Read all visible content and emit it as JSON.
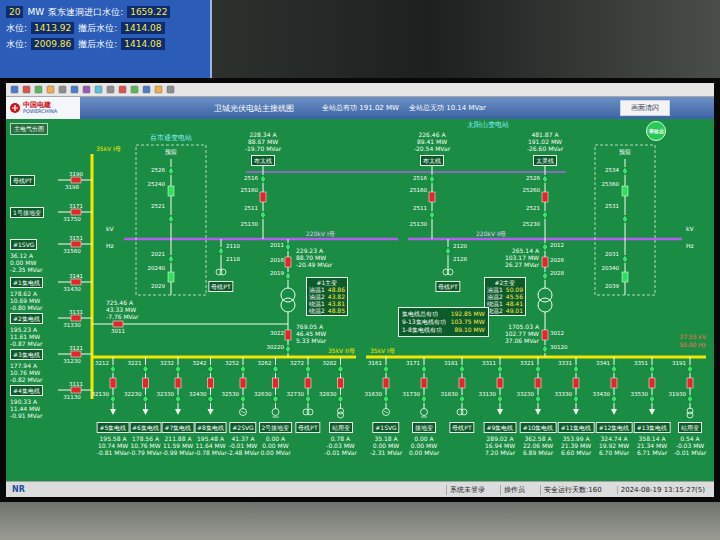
{
  "background_window": {
    "rows": [
      {
        "cells": [
          {
            "text": "20",
            "kind": "value"
          },
          {
            "text": "MW",
            "kind": "label"
          },
          {
            "text": "泵东速洞进口水位:",
            "kind": "label"
          },
          {
            "text": "1659.22",
            "kind": "value"
          }
        ]
      },
      {
        "cells": [
          {
            "text": "水位:",
            "kind": "label"
          },
          {
            "text": "1413.92",
            "kind": "value"
          },
          {
            "text": "撤后水位:",
            "kind": "label"
          },
          {
            "text": "1414.08",
            "kind": "value"
          }
        ]
      },
      {
        "cells": [
          {
            "text": "水位:",
            "kind": "label"
          },
          {
            "text": "2009.86",
            "kind": "value"
          },
          {
            "text": "撤后水位:",
            "kind": "label"
          },
          {
            "text": "1414.08",
            "kind": "value"
          }
        ]
      }
    ]
  },
  "header": {
    "logo": {
      "name": "中国电建",
      "sub": "POWERCHINA"
    },
    "title": "卫城光伏电站主接线图",
    "totals": [
      {
        "label": "全站总有功",
        "value": "191.02 MW"
      },
      {
        "label": "全站总无功",
        "value": "10.14 MVar"
      }
    ],
    "button": "画面清闪"
  },
  "diagram": {
    "nav_button": "主电气分图",
    "accident_lamp": {
      "label": "事故总",
      "active": false
    },
    "stations": [
      "百市通变电站",
      "太阳山变电站"
    ],
    "bus_labels": [
      "35kV I母",
      "35kV II母",
      "35kV I母",
      "220kV I母",
      "220kV II母"
    ],
    "bus220_units": [
      {
        "kv": "kV",
        "hz": "Hz"
      },
      {
        "kv": "kV",
        "hz": "Hz"
      }
    ],
    "bus35_reading": {
      "kv": "37.55 kV",
      "hz": "50.00 Hz"
    },
    "lines": [
      {
        "label": "布太线",
        "readings": [
          "228.34 A",
          "88.67 MW",
          "-19.70 MVar"
        ],
        "switches": [
          "2516",
          "25160",
          "2511",
          "25130"
        ],
        "breaker_closed": true
      },
      {
        "label": "布太线",
        "readings": [
          "226.46 A",
          "89.41 MW",
          "-20.54 MVar"
        ],
        "switches": [
          "2516",
          "25160",
          "2511",
          "25130"
        ],
        "breaker_closed": true
      },
      {
        "label": "太灵线",
        "readings": [
          "481.87 A",
          "191.02 MW",
          "-26.60 MVar"
        ],
        "switches": [
          "2526",
          "25260",
          "2521",
          "25230"
        ],
        "breaker_closed": true
      }
    ],
    "reserves": [
      {
        "label": "预留",
        "switches": [
          "2526",
          "25240",
          "2521",
          "2021",
          "20240",
          "2029"
        ],
        "breaker_closed": false
      },
      {
        "label": "预留",
        "switches": [
          "2534",
          "25360",
          "2531",
          "2031",
          "20340",
          "2039"
        ],
        "breaker_closed": false
      }
    ],
    "pts": [
      {
        "label": "母线PT",
        "switches": [
          "2110",
          "2118"
        ]
      },
      {
        "label": "母线PT",
        "switches": [
          "2120",
          "2128"
        ]
      }
    ],
    "transformers": [
      {
        "name": "#1主变",
        "breaker_closed": true,
        "temps": [
          {
            "label": "油温1",
            "value": "48.86"
          },
          {
            "label": "油温2",
            "value": "43.82"
          },
          {
            "label": "绕温1",
            "value": "43.81"
          },
          {
            "label": "绕温2",
            "value": "48.85"
          }
        ],
        "hv": {
          "switches": [
            "2011",
            "2016",
            "2019"
          ],
          "readings": [
            "229.23 A",
            "88.70 MW",
            "-20.49 MVar"
          ]
        },
        "lv": {
          "switches": [
            "3022",
            "30220"
          ],
          "readings": [
            "769.05 A",
            "46.45 MW",
            "5.33 MVar"
          ]
        },
        "link": {
          "switch": "3011",
          "readings": [
            "725.46 A",
            "43.33 MW",
            "-7.76 MVar"
          ],
          "breaker_closed": true
        }
      },
      {
        "name": "#2主变",
        "breaker_closed": true,
        "temps": [
          {
            "label": "油温1",
            "value": "50.09"
          },
          {
            "label": "油温2",
            "value": "45.56"
          },
          {
            "label": "绕温1",
            "value": "48.41"
          },
          {
            "label": "绕温2",
            "value": "49.01"
          }
        ],
        "hv": {
          "switches": [
            "2012",
            "2026",
            "2028"
          ],
          "readings": [
            "265.14 A",
            "103.17 MW",
            "26.27 MVar"
          ]
        },
        "lv": {
          "switches": [
            "3012",
            "30120"
          ],
          "readings": [
            "1705.03 A",
            "102.77 MW",
            "37.06 MVar"
          ]
        }
      }
    ],
    "summary": {
      "rows": [
        {
          "label": "集电线总有功",
          "value": "192.85 MW"
        },
        {
          "label": "9-13集电线有功",
          "value": "103.75 MW"
        },
        {
          "label": "1-8集电线有功",
          "value": "89.10 MW"
        }
      ]
    },
    "left_feeders": [
      {
        "label": "母线PT",
        "switches": [
          "3190",
          "3198"
        ],
        "readings": [],
        "breaker_closed": true
      },
      {
        "label": "1号接地变",
        "switches": [
          "3171",
          "31750"
        ],
        "readings": [],
        "breaker_closed": true
      },
      {
        "label": "#1SVG",
        "switches": [
          "3151",
          "31560"
        ],
        "readings": [
          "36.12 A",
          "0.00 MW",
          "-2.35 MVar"
        ],
        "breaker_closed": true
      },
      {
        "label": "#1集电线",
        "switches": [
          "3141",
          "31430"
        ],
        "readings": [
          "178.62 A",
          "10.69 MW",
          "-0.80 MVar"
        ],
        "breaker_closed": true
      },
      {
        "label": "#2集电线",
        "switches": [
          "3131",
          "31330"
        ],
        "readings": [
          "195.23 A",
          "11.61 MW",
          "-0.87 MVar"
        ],
        "breaker_closed": true
      },
      {
        "label": "#3集电线",
        "switches": [
          "3121",
          "31230"
        ],
        "readings": [
          "177.94 A",
          "10.76 MW",
          "-0.82 MVar"
        ],
        "breaker_closed": true
      },
      {
        "label": "#4集电线",
        "switches": [
          "3111",
          "31130"
        ],
        "readings": [
          "190.33 A",
          "11.44 MW",
          "-0.91 MVar"
        ],
        "breaker_closed": true
      }
    ],
    "bottom_feeders": {
      "left": [
        {
          "label": "#5集电线",
          "kind": "arrow",
          "switches": [
            "3212",
            "32130"
          ],
          "readings": [
            "195.58 A",
            "10.74 MW",
            "-0.81 MVar"
          ],
          "breaker_closed": true
        },
        {
          "label": "#6集电线",
          "kind": "arrow",
          "switches": [
            "3221",
            "32230"
          ],
          "readings": [
            "178.56 A",
            "10.76 MW",
            "-0.79 MVar"
          ],
          "breaker_closed": true
        },
        {
          "label": "#7集电线",
          "kind": "arrow",
          "switches": [
            "3232",
            "32330"
          ],
          "readings": [
            "211.88 A",
            "11.59 MW",
            "-0.99 MVar"
          ],
          "breaker_closed": true
        },
        {
          "label": "#8集电线",
          "kind": "arrow",
          "switches": [
            "3242",
            "32430"
          ],
          "readings": [
            "195.48 A",
            "11.64 MW",
            "-0.78 MVar"
          ],
          "breaker_closed": true
        },
        {
          "label": "#2SVG",
          "kind": "svg",
          "switches": [
            "3252",
            "32530"
          ],
          "readings": [
            "41.37 A",
            "-0.01 MW",
            "-2.48 MVar"
          ],
          "breaker_closed": true
        },
        {
          "label": "2号接地变",
          "kind": "ground",
          "switches": [
            "3262",
            "32630"
          ],
          "readings": [
            "0.00 A",
            "0.00 MW",
            "0.00 MVar"
          ],
          "breaker_closed": true
        },
        {
          "label": "母线PT",
          "kind": "pt",
          "switches": [
            "3272",
            "32730"
          ],
          "readings": [],
          "breaker_closed": true
        },
        {
          "label": "站用变",
          "kind": "transformer",
          "switches": [
            "3282",
            "32830"
          ],
          "readings": [
            "0.78 A",
            "-0.03 MW",
            "-0.01 MVar"
          ],
          "breaker_closed": true
        }
      ],
      "right": [
        {
          "label": "#1SVG",
          "kind": "svg",
          "switches": [
            "3161",
            "31630"
          ],
          "readings": [
            "35.18 A",
            "0.00 MW",
            "-2.31 MVar"
          ],
          "breaker_closed": true
        },
        {
          "label": "接地变",
          "kind": "ground",
          "switches": [
            "3171",
            "31730"
          ],
          "readings": [
            "0.00 A",
            "0.00 MW",
            "0.00 MVar"
          ],
          "breaker_closed": true
        },
        {
          "label": "母线PT",
          "kind": "pt",
          "switches": [
            "3181",
            "31830"
          ],
          "readings": [],
          "breaker_closed": true
        },
        {
          "label": "#9集电线",
          "kind": "arrow",
          "switches": [
            "3311",
            "33130"
          ],
          "readings": [
            "289.02 A",
            "16.94 MW",
            "7.20 MVar"
          ],
          "breaker_closed": true
        },
        {
          "label": "#10集电线",
          "kind": "arrow",
          "switches": [
            "3321",
            "33230"
          ],
          "readings": [
            "362.58 A",
            "22.06 MW",
            "6.89 MVar"
          ],
          "breaker_closed": true
        },
        {
          "label": "#11集电线",
          "kind": "arrow",
          "switches": [
            "3331",
            "33330"
          ],
          "readings": [
            "353.99 A",
            "21.39 MW",
            "6.60 MVar"
          ],
          "breaker_closed": true
        },
        {
          "label": "#12集电线",
          "kind": "arrow",
          "switches": [
            "3341",
            "33430"
          ],
          "readings": [
            "324.74 A",
            "19.92 MW",
            "6.70 MVar"
          ],
          "breaker_closed": true
        },
        {
          "label": "#13集电线",
          "kind": "arrow",
          "switches": [
            "3351",
            "33530"
          ],
          "readings": [
            "358.14 A",
            "21.34 MW",
            "6.71 MVar"
          ],
          "breaker_closed": true
        },
        {
          "label": "站用变",
          "kind": "transformer",
          "switches": [
            "3191",
            "31930"
          ],
          "readings": [
            "0.54 A",
            "-0.03 MW",
            "-0.01 MVar"
          ],
          "breaker_closed": true
        }
      ]
    }
  },
  "status_bar": {
    "logo": "NR",
    "items": [
      "系统未登录",
      "操作员",
      "安全运行天数:160",
      "2024-08-19 13:15:27(5)"
    ]
  }
}
